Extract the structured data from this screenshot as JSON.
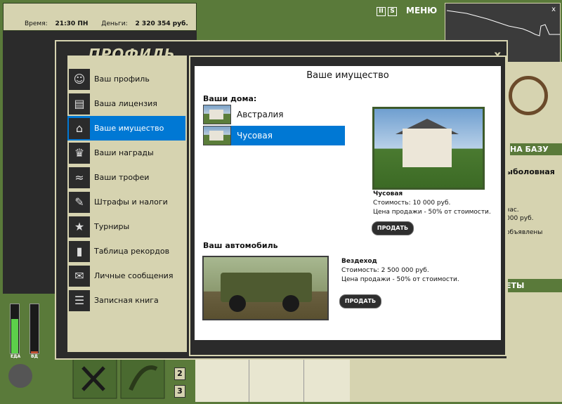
{
  "status": {
    "time_label": "Время:",
    "time_value": "21:30 ПН",
    "money_label": "Деньги:",
    "money_value": "2 320 354 руб."
  },
  "top": {
    "pause_icon": "pause-icon",
    "sound_icon": "sound-icon",
    "menu_label": "МЕНЮ"
  },
  "graph": {
    "close": "x"
  },
  "right": {
    "banner": "НА БАЗУ",
    "heading": "ыболовная",
    "line1": "час.",
    "line2": "000 руб.",
    "line3": "объявлены",
    "banner2": "ЕТЫ"
  },
  "meters": {
    "food_label": "ЕДА",
    "water_label": "ВД",
    "food_level": 0.7,
    "water_level": 0.05
  },
  "tools": {
    "num2": "2",
    "num3": "3"
  },
  "modal": {
    "title": "ПРОФИЛЬ",
    "close": "x",
    "menu": [
      {
        "label": "Ваш профиль",
        "icon": "profile-icon"
      },
      {
        "label": "Ваша лицензия",
        "icon": "license-icon"
      },
      {
        "label": "Ваше имущество",
        "icon": "house-icon"
      },
      {
        "label": "Ваши награды",
        "icon": "trophy-icon"
      },
      {
        "label": "Ваши трофеи",
        "icon": "fish-icon"
      },
      {
        "label": "Штрафы и налоги",
        "icon": "document-icon"
      },
      {
        "label": "Турниры",
        "icon": "tournament-icon"
      },
      {
        "label": "Таблица рекордов",
        "icon": "chart-icon"
      },
      {
        "label": "Личные сообщения",
        "icon": "envelope-icon"
      },
      {
        "label": "Записная книга",
        "icon": "notebook-icon"
      }
    ],
    "content": {
      "title": "Ваше имущество",
      "houses_title": "Ваши дома:",
      "houses": [
        "Австралия",
        "Чусовая"
      ],
      "selected_house": {
        "name": "Чусовая",
        "cost": "Стоимость: 10 000 руб.",
        "sale": "Цена продажи - 50% от стоимости.",
        "sell": "ПРОДАТЬ"
      },
      "car_title": "Ваш автомобиль",
      "car": {
        "name": "Вездеход",
        "cost": "Стоимость: 2 500 000 руб.",
        "sale": "Цена продажи - 50% от стоимости.",
        "sell": "ПРОДАТЬ"
      }
    }
  }
}
